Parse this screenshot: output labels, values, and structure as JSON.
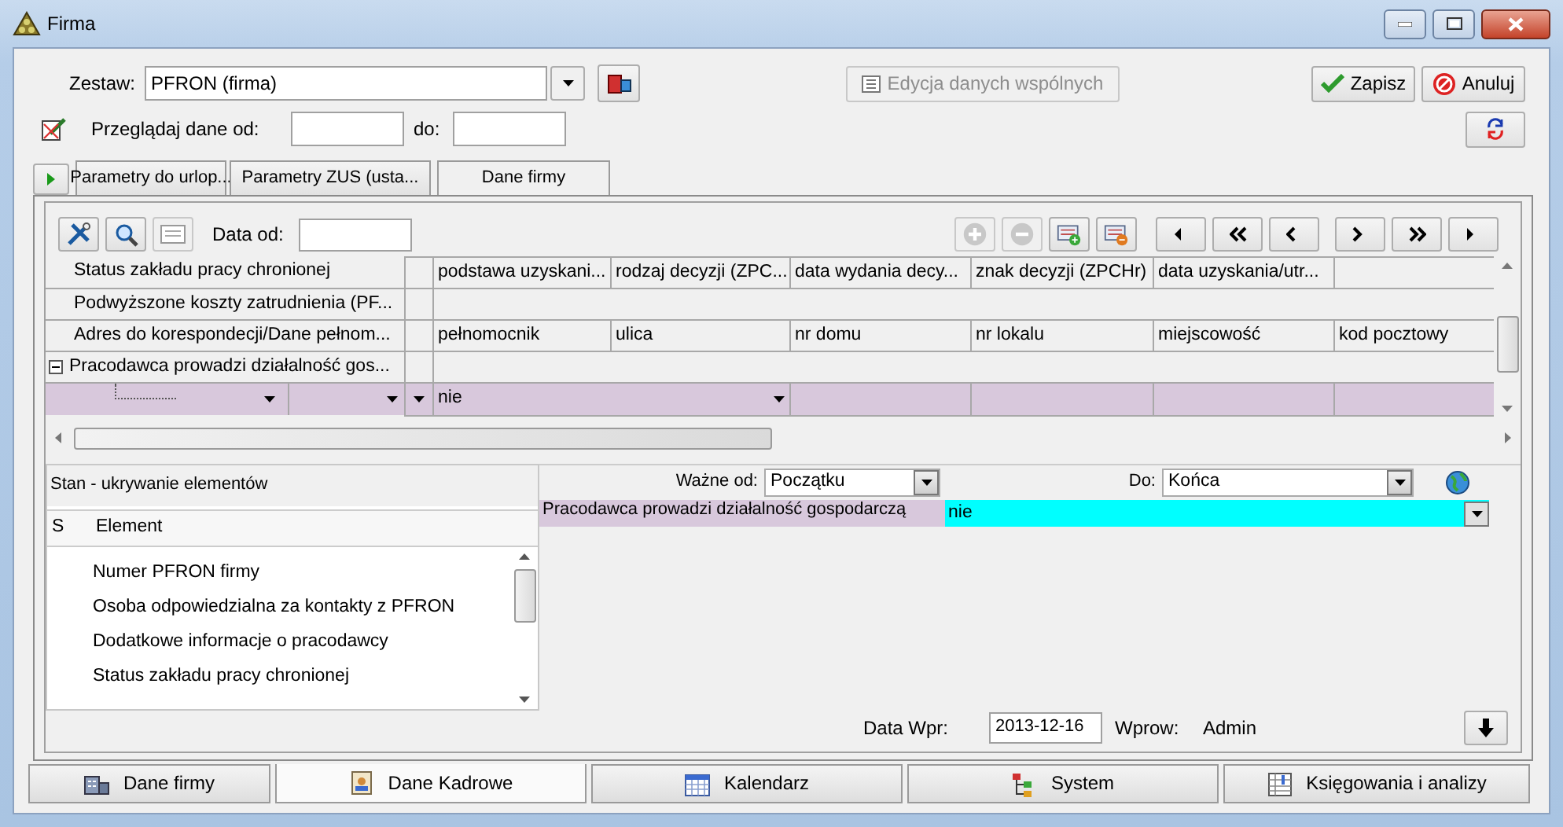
{
  "window": {
    "title": "Firma"
  },
  "zestaw": {
    "label": "Zestaw:",
    "value": "PFRON (firma)"
  },
  "shared_data_button": {
    "label": "Edycja danych wspólnych",
    "disabled": true
  },
  "actions": [
    {
      "label": "Zapisz",
      "kind": "save"
    },
    {
      "label": "Anuluj",
      "kind": "cancel"
    }
  ],
  "browse": {
    "label": "Przeglądaj dane od:",
    "to_label": "do:"
  },
  "top_tabs": [
    {
      "label": "Parametry do urlop...",
      "selected": false
    },
    {
      "label": "Parametry ZUS (usta...",
      "selected": false
    },
    {
      "label": "Dane firmy",
      "selected": true
    }
  ],
  "toolbar": {
    "date_label": "Data od:",
    "add_disabled": true,
    "remove_disabled": true
  },
  "grid": {
    "rows": [
      {
        "kind": "item",
        "label": "Status zakładu pracy chronionej",
        "cells": [
          "podstawa uzyskani...",
          "rodzaj decyzji (ZPC...",
          "data wydania decy...",
          "znak decyzji (ZPCHr)",
          "data uzyskania/utr..."
        ]
      },
      {
        "kind": "item",
        "label": "Podwyższone koszty zatrudnienia (PF..."
      },
      {
        "kind": "item",
        "label": "Adres do korespondecji/Dane pełnom...",
        "cells": [
          "pełnomocnik",
          "ulica",
          "nr domu",
          "nr lokalu",
          "miejscowość",
          "kod pocztowy"
        ]
      },
      {
        "kind": "group",
        "label": "Pracodawca prowadzi działalność gos...",
        "expanded": true
      },
      {
        "kind": "editor",
        "value": "nie",
        "selected": true
      }
    ]
  },
  "visibility_panel": {
    "title": "Stan - ukrywanie elementów",
    "columns": [
      "S",
      "Element"
    ],
    "items": [
      "Numer PFRON firmy",
      "Osoba odpowiedzialna za kontakty z PFRON",
      "Dodatkowe informacje o pracodawcy",
      "Status zakładu pracy chronionej"
    ]
  },
  "detail": {
    "valid_from_label": "Ważne od:",
    "valid_from": "Początku",
    "valid_to_label": "Do:",
    "valid_to": "Końca",
    "field_label": "Pracodawca prowadzi działalność gospodarczą",
    "field_value": "nie"
  },
  "footer": {
    "date_label": "Data Wpr:",
    "date": "2013-12-16",
    "user_label": "Wprow:",
    "user": "Admin"
  },
  "bottom_tabs": [
    {
      "label": "Dane firmy",
      "selected": false
    },
    {
      "label": "Dane Kadrowe",
      "selected": true
    },
    {
      "label": "Kalendarz",
      "selected": false
    },
    {
      "label": "System",
      "selected": false
    },
    {
      "label": "Księgowania i analizy",
      "selected": false
    }
  ]
}
